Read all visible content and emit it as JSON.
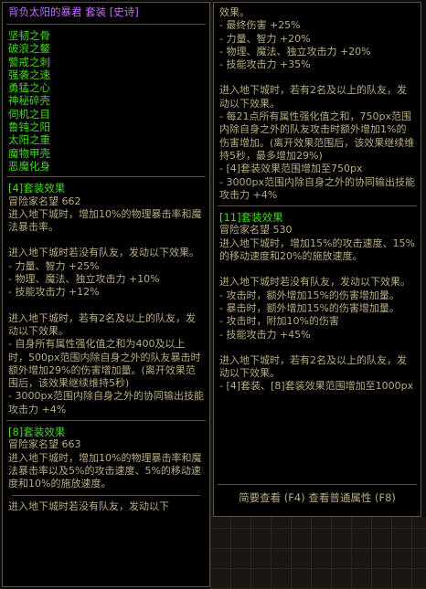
{
  "tooltip": {
    "title": "背负太阳的暴君 套装 [史诗]",
    "pieces": [
      "坚韧之骨",
      "破浪之鳌",
      "警戒之刺",
      "强袭之速",
      "勇猛之心",
      "神秘碎壳",
      "伺机之目",
      "鲁钝之阳",
      "太阳之重",
      "魔物甲壳",
      "恶魔化身"
    ],
    "set4": {
      "head": "[4]套装效果",
      "fame": "冒险家名望 662",
      "p1": "进入地下城时，增加10%的物理暴击率和魔法暴击率。",
      "p2": "进入地下城时若没有队友，发动以下效果。\n- 力量、智力 +25%\n- 物理、魔法、独立攻击力 +10%\n- 技能攻击力 +12%",
      "p3": "进入地下城时，若有2名及以上的队友，发动以下效果。\n- 自身所有属性强化值之和为400及以上时，500px范围内除自身之外的队友暴击时额外增加29%的伤害增加量。(离开效果范围后，该效果继续维持5秒)\n- 3000px范围内除自身之外的协同输出技能攻击力 +4%"
    },
    "set8": {
      "head": "[8]套装效果",
      "fame": "冒险家名望 663",
      "p1": "进入地下城时，增加10%的物理暴击率和魔法暴击率以及5%的攻击速度、5%的移动速度和10%的施放速度。",
      "p2": "进入地下城时若没有队友，发动以下"
    },
    "right": {
      "p0": "效果。\n- 最终伤害 +25%\n- 力量、智力 +20%\n- 物理、魔法、独立攻击力 +20%\n- 技能攻击力 +35%",
      "p1": "进入地下城时，若有2名及以上的队友，发动以下效果。\n- 每21点所有属性强化值之和，750px范围内除自身之外的队友攻击时额外增加1%的伤害增加。(离开效果范围后，该效果继续维持5秒，最多增加29%)\n- [4]套装效果范围增加至750px\n- 3000px范围内除自身之外的协同输出技能攻击力 +4%"
    },
    "set11": {
      "head": "[11]套装效果",
      "fame": "冒险家名望 530",
      "p1": "进入地下城时，增加15%的攻击速度、15%的移动速度和20%的施放速度。",
      "p2": "进入地下城时若没有队友，发动以下效果。\n- 攻击时，额外增加15%的伤害增加量。\n- 暴击时，额外增加15%的伤害增加量。\n- 攻击时，附加10%的伤害\n- 技能攻击力 +45%",
      "p3": "进入地下城时，若有2名及以上的队友，发动以下效果。\n- [4]套装、[8]套装效果范围增加至1000px"
    },
    "footer": "简要查看 (F4) 查看普通属性 (F8)"
  }
}
